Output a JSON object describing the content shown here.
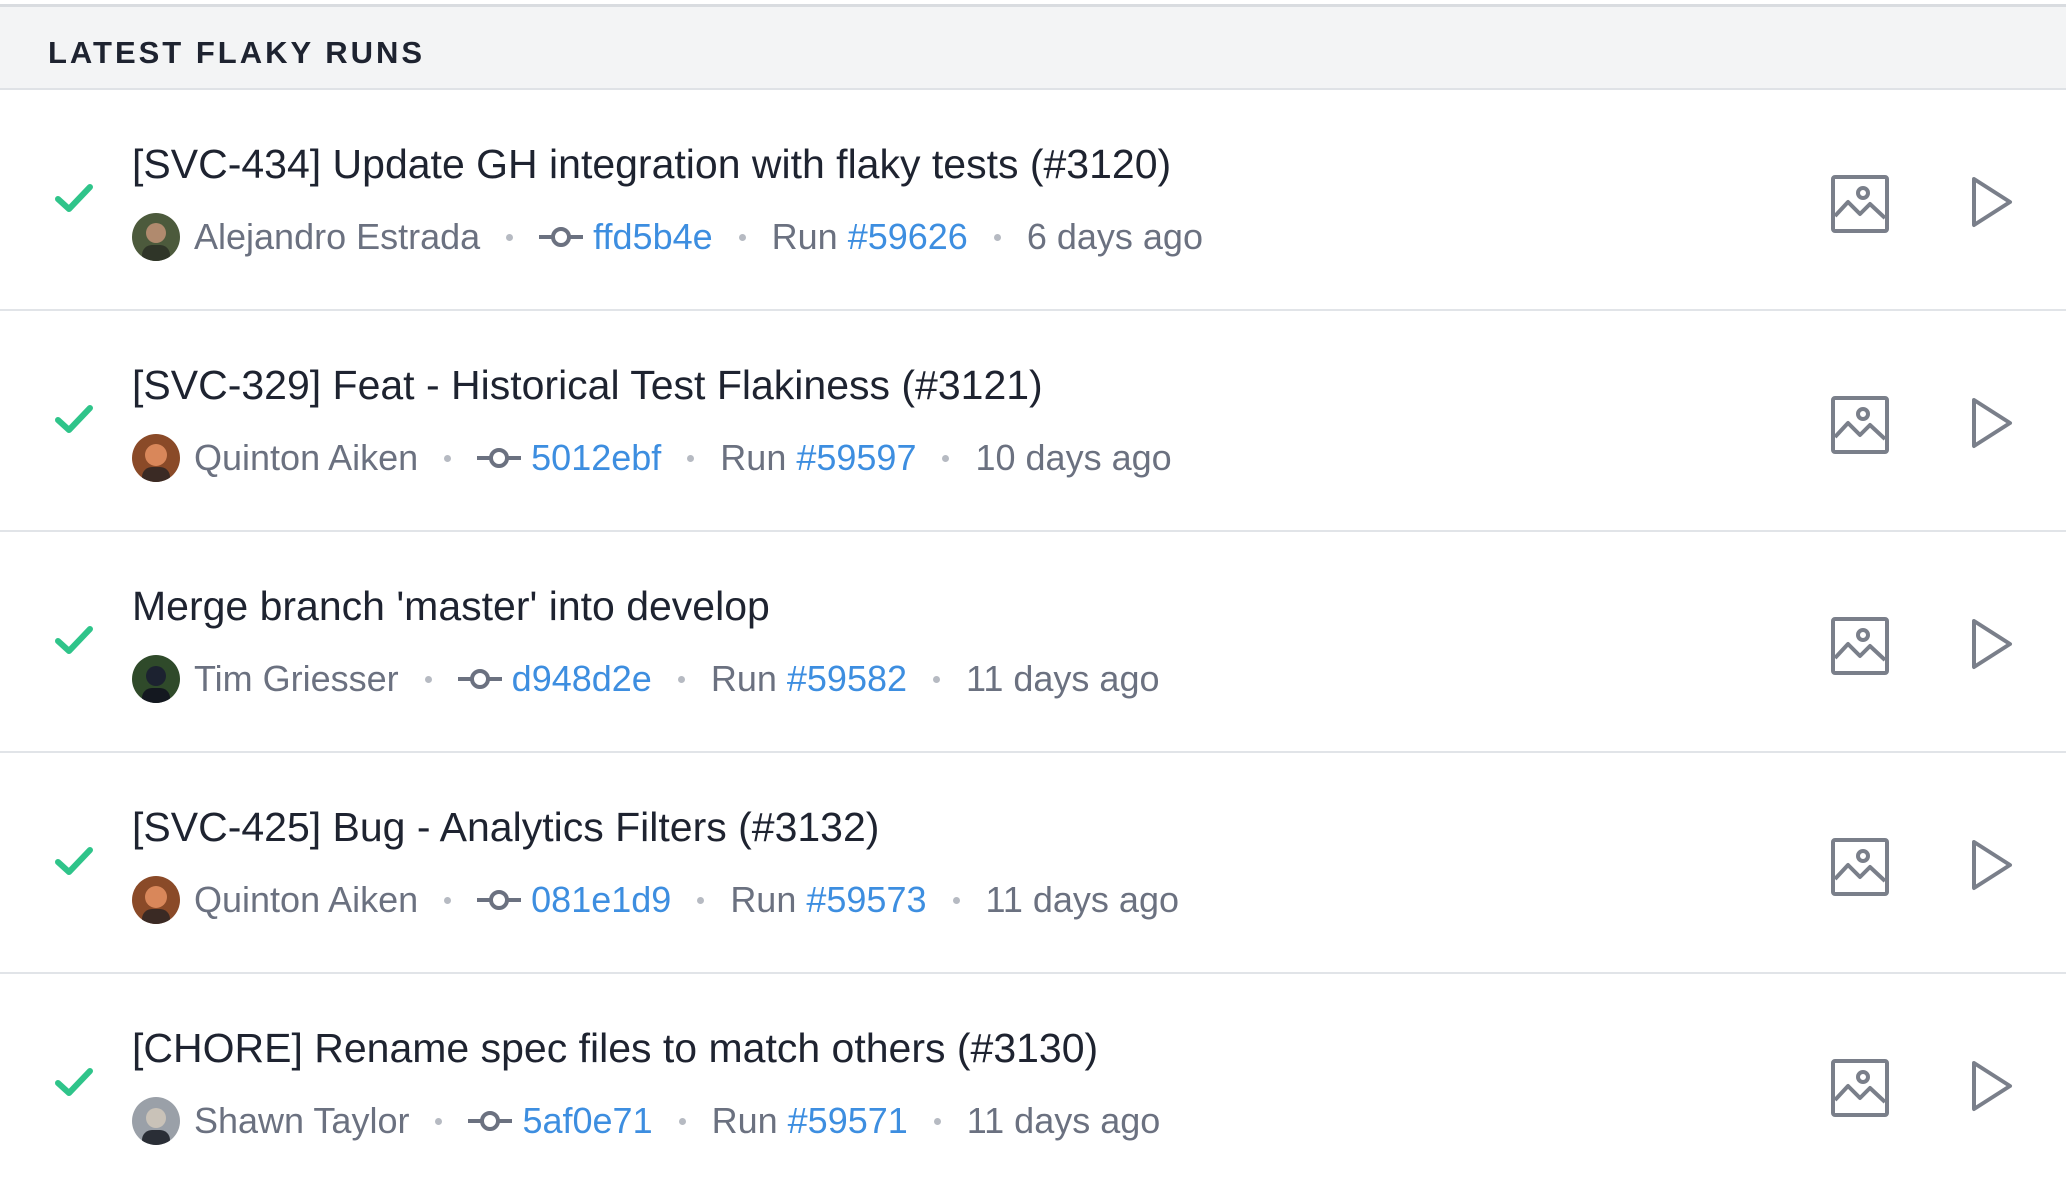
{
  "panel": {
    "title": "LATEST FLAKY RUNS"
  },
  "colors": {
    "success": "#2fc48a",
    "link": "#3d8ee0",
    "muted": "#6b7180",
    "text": "#1e2330",
    "icon": "#7a7f8a"
  },
  "runs": [
    {
      "status": "passed",
      "status_icon": "check-icon",
      "title": "[SVC-434] Update GH integration with flaky tests (#3120)",
      "author": "Alejandro Estrada",
      "commit": "ffd5b4e",
      "run_label": "Run",
      "run_number": "#59626",
      "time": "6 days ago"
    },
    {
      "status": "passed",
      "status_icon": "check-icon",
      "title": "[SVC-329] Feat - Historical Test Flakiness (#3121)",
      "author": "Quinton Aiken",
      "commit": "5012ebf",
      "run_label": "Run",
      "run_number": "#59597",
      "time": "10 days ago"
    },
    {
      "status": "passed",
      "status_icon": "check-icon",
      "title": "Merge branch 'master' into develop",
      "author": "Tim Griesser",
      "commit": "d948d2e",
      "run_label": "Run",
      "run_number": "#59582",
      "time": "11 days ago"
    },
    {
      "status": "passed",
      "status_icon": "check-icon",
      "title": "[SVC-425] Bug - Analytics Filters (#3132)",
      "author": "Quinton Aiken",
      "commit": "081e1d9",
      "run_label": "Run",
      "run_number": "#59573",
      "time": "11 days ago"
    },
    {
      "status": "passed",
      "status_icon": "check-icon",
      "title": "[CHORE] Rename spec files to match others (#3130)",
      "author": "Shawn Taylor",
      "commit": "5af0e71",
      "run_label": "Run",
      "run_number": "#59571",
      "time": "11 days ago"
    }
  ]
}
